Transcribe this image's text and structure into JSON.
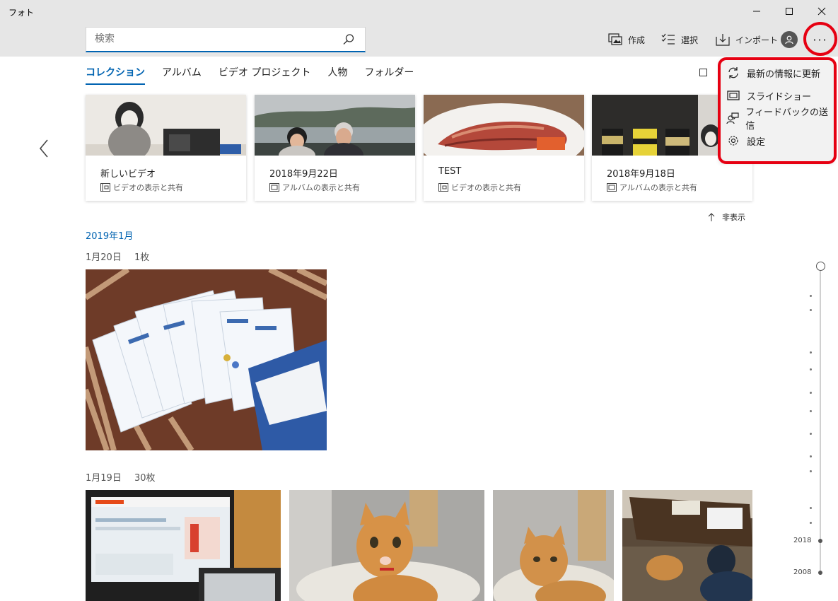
{
  "window": {
    "title": "フォト"
  },
  "search": {
    "placeholder": "検索"
  },
  "toolbar": {
    "create_label": "作成",
    "select_label": "選択",
    "import_label": "インポート",
    "more_label": "···"
  },
  "tabs": [
    {
      "label": "コレクション",
      "active": true
    },
    {
      "label": "アルバム"
    },
    {
      "label": "ビデオ プロジェクト"
    },
    {
      "label": "人物"
    },
    {
      "label": "フォルダー"
    }
  ],
  "cards": [
    {
      "title": "新しいビデオ",
      "sub": "ビデオの表示と共有",
      "icon": "video-icon"
    },
    {
      "title": "2018年9月22日",
      "sub": "アルバムの表示と共有",
      "icon": "album-icon"
    },
    {
      "title": "TEST",
      "sub": "ビデオの表示と共有",
      "icon": "video-icon"
    },
    {
      "title": "2018年9月18日",
      "sub": "アルバムの表示と共有",
      "icon": "album-icon"
    }
  ],
  "hide_label": "非表示",
  "month_header": "2019年1月",
  "groups": [
    {
      "date": "1月20日",
      "count": "1枚"
    },
    {
      "date": "1月19日",
      "count": "30枚"
    }
  ],
  "timeline": {
    "years": [
      "2018",
      "2008"
    ]
  },
  "menu": {
    "items": [
      {
        "label": "最新の情報に更新",
        "icon": "refresh-icon"
      },
      {
        "label": "スライドショー",
        "icon": "slideshow-icon"
      },
      {
        "label": "フィードバックの送信",
        "icon": "feedback-icon"
      },
      {
        "label": "設定",
        "icon": "gear-icon"
      }
    ]
  },
  "colors": {
    "accent": "#0063b1",
    "highlight": "#e60012",
    "chrome": "#e6e6e6"
  }
}
